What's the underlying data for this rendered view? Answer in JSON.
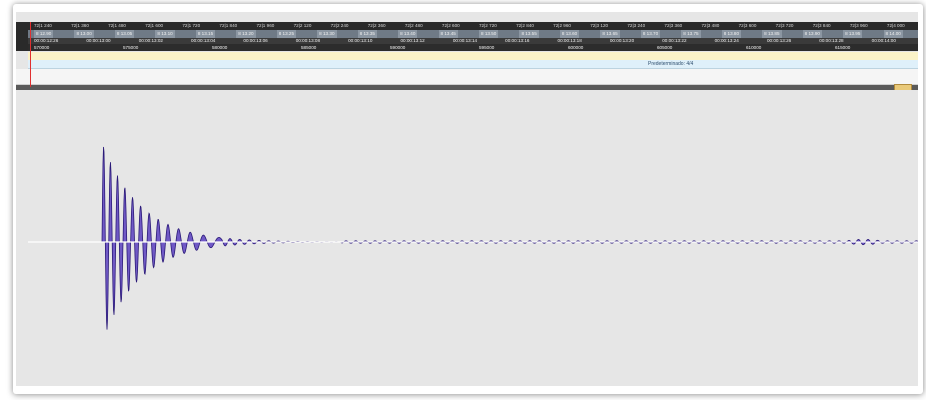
{
  "ruler": {
    "bar_labels": [
      "72|1 240",
      "72|1 360",
      "72|1 480",
      "72|1 600",
      "72|1 720",
      "72|1 840",
      "72|1 960",
      "72|2 120",
      "72|2 240",
      "72|2 360",
      "72|2 480",
      "72|2 600",
      "72|2 720",
      "72|2 840",
      "72|2 960",
      "72|3 120",
      "72|3 240",
      "72|3 360",
      "72|3 480",
      "72|3 600",
      "72|3 720",
      "72|3 840",
      "72|3 960",
      "72|4 000"
    ],
    "beat_labels": [
      "8 12.90",
      "8 13.00",
      "8 13.05",
      "8 13.10",
      "8 13.15",
      "8 13.20",
      "8 13.25",
      "8 13.30",
      "8 13.35",
      "8 13.40",
      "8 13.45",
      "8 13.50",
      "8 13.55",
      "8 13.60",
      "8 13.65",
      "8 13.70",
      "8 13.75",
      "8 13.80",
      "8 13.85",
      "8 13.90",
      "8 13.95",
      "8 14.00"
    ],
    "time_labels": [
      "00:00:12:26",
      "00:00:13:00",
      "00:00:13:02",
      "00:00:13:04",
      "00:00:13:06",
      "00:00:13:08",
      "00:00:13:10",
      "00:00:13:12",
      "00:00:13:14",
      "00:00:13:16",
      "00:00:13:18",
      "00:00:13:20",
      "00:00:13:22",
      "00:00:13:24",
      "00:00:13:26",
      "00:00:13:28",
      "00:00:14:00"
    ],
    "sample_labels": [
      "570000",
      "575000",
      "580000",
      "585000",
      "590000",
      "595000",
      "600000",
      "605000",
      "610000",
      "615000"
    ]
  },
  "time_signature": {
    "label": "Predeterminado: 4/4"
  },
  "colors": {
    "waveform": "#5a3fc0",
    "waveform_edge": "#2b1a78",
    "center_line": "#ffffff",
    "background": "#e6e6e6",
    "playhead": "#e03030"
  },
  "icons": {
    "playhead": "playhead-marker-icon",
    "region_marker": "region-marker-icon"
  }
}
